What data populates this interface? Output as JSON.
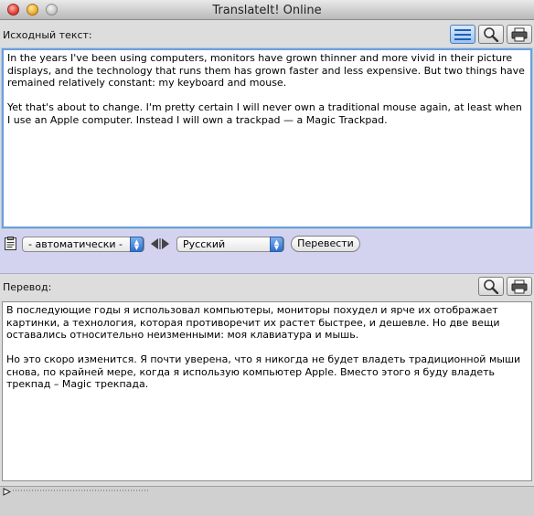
{
  "window": {
    "title": "TranslateIt! Online"
  },
  "source": {
    "label": "Исходный текст:",
    "text": "In the years I've been using computers, monitors have grown thinner and more vivid in their picture displays, and the technology that runs them has grown faster and less expensive. But two things have remained relatively constant: my keyboard and mouse.\n\nYet that's about to change. I'm pretty certain I will never own a traditional mouse again, at least when I use an Apple computer. Instead I will own a trackpad — a Magic Trackpad."
  },
  "controls": {
    "from_language": "- автоматически -",
    "to_language": "Русский",
    "translate_button": "Перевести"
  },
  "translation": {
    "label": "Перевод:",
    "text": "В последующие годы я использовал компьютеры, мониторы похудел и ярче их отображает картинки, а технология, которая противоречит их растет быстрее, и дешевле. Но две вещи оставались относительно неизменными: моя клавиатура и мышь.\n\nНо это скоро изменится. Я почти уверена, что я никогда не будет владеть традиционной мыши снова, по крайней мере, когда я использую компьютер Apple. Вместо этого я буду владеть трекпад – Magic трекпада."
  },
  "icons": {
    "list": "list-icon",
    "zoom": "magnifier-icon",
    "print": "printer-icon",
    "clipboard": "clipboard-icon",
    "swap": "swap-arrows-icon",
    "play": "play-icon"
  },
  "colors": {
    "focus_ring": "#6f9fd8",
    "control_band": "#d3d3f0",
    "popup_arrow": "#2d6fd0"
  }
}
